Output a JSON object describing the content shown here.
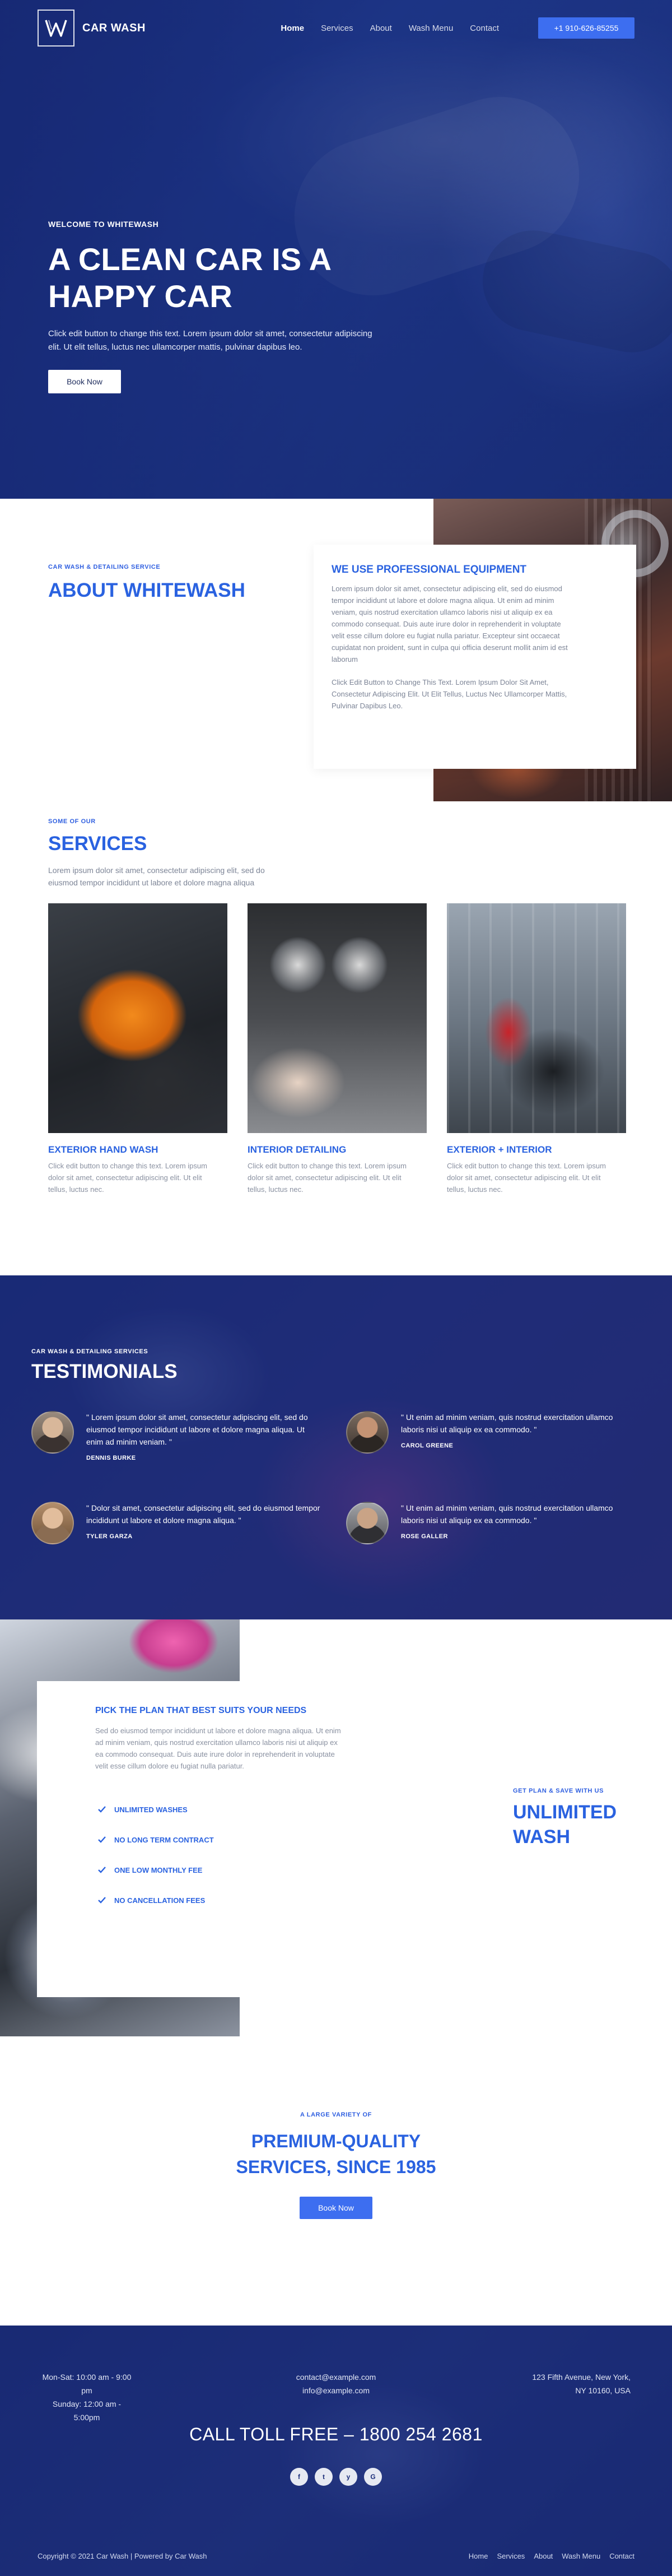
{
  "colors": {
    "brand_blue": "#2a62e0",
    "button_blue": "#3d6ef0",
    "dark_navy": "#1a2c78",
    "text_gray": "#7d8597"
  },
  "header": {
    "logo_icon": "w-monogram-logo",
    "brand": "CAR WASH",
    "nav": [
      "Home",
      "Services",
      "About",
      "Wash Menu",
      "Contact"
    ],
    "active_nav": "Home",
    "phone": "+1 910-626-85255"
  },
  "hero": {
    "eyebrow": "WELCOME TO WHITEWASH",
    "title": "A CLEAN CAR IS A HAPPY CAR",
    "text": "Click edit button to change this text. Lorem ipsum dolor sit amet, consectetur adipiscing elit. Ut elit tellus, luctus nec ullamcorper mattis, pulvinar dapibus leo.",
    "button": "Book Now"
  },
  "about": {
    "eyebrow": "CAR WASH & DETAILING SERVICE",
    "title": "ABOUT WHITEWASH",
    "card_heading": "WE USE PROFESSIONAL EQUIPMENT",
    "text1": "Lorem ipsum dolor sit amet, consectetur adipiscing elit, sed do eiusmod tempor incididunt ut labore et dolore magna aliqua. Ut enim ad minim veniam, quis nostrud exercitation ullamco laboris nisi ut aliquip ex ea commodo consequat. Duis aute irure dolor in reprehenderit in voluptate velit esse cillum dolore eu fugiat nulla pariatur. Excepteur sint occaecat cupidatat non proident, sunt in culpa qui officia deserunt mollit anim id est laborum",
    "text2": "Click Edit Button to Change This Text. Lorem Ipsum Dolor Sit Amet, Consectetur Adipiscing Elit. Ut Elit Tellus, Luctus Nec Ullamcorper Mattis, Pulvinar Dapibus Leo."
  },
  "services": {
    "eyebrow": "SOME OF OUR",
    "title": "SERVICES",
    "intro": "Lorem ipsum dolor sit amet, consectetur adipiscing elit, sed do eiusmod tempor incididunt ut labore et dolore magna aliqua",
    "items": [
      {
        "name": "EXTERIOR HAND WASH",
        "text": "Click edit button to change this text. Lorem ipsum dolor sit amet, consectetur adipiscing elit. Ut elit tellus, luctus nec."
      },
      {
        "name": "INTERIOR DETAILING",
        "text": "Click edit button to change this text. Lorem ipsum dolor sit amet, consectetur adipiscing elit. Ut elit tellus, luctus nec."
      },
      {
        "name": "EXTERIOR + INTERIOR",
        "text": "Click edit button to change this text. Lorem ipsum dolor sit amet, consectetur adipiscing elit. Ut elit tellus, luctus nec."
      }
    ]
  },
  "testimonials": {
    "eyebrow": "CAR WASH & DETAILING SERVICES",
    "title": "TESTIMONIALS",
    "items": [
      {
        "quote": "\" Lorem ipsum dolor sit amet, consectetur adipiscing elit, sed do eiusmod tempor incididunt ut labore et dolore magna aliqua. Ut enim ad minim veniam. \"",
        "author": "DENNIS BURKE"
      },
      {
        "quote": "\" Ut enim ad minim veniam, quis nostrud exercitation ullamco laboris nisi ut aliquip ex ea commodo. \"",
        "author": "CAROL GREENE"
      },
      {
        "quote": "\" Dolor sit amet, consectetur adipiscing elit, sed do eiusmod tempor incididunt ut labore et dolore magna aliqua. \"",
        "author": "TYLER GARZA"
      },
      {
        "quote": "\" Ut enim ad minim veniam, quis nostrud exercitation ullamco laboris nisi ut aliquip ex ea commodo. \"",
        "author": "ROSE GALLER"
      }
    ]
  },
  "plans": {
    "heading": "PICK THE PLAN THAT BEST SUITS YOUR NEEDS",
    "text": "Sed do eiusmod tempor incididunt ut labore et dolore magna aliqua. Ut enim ad minim veniam, quis nostrud exercitation ullamco laboris nisi ut aliquip ex ea commodo consequat. Duis aute irure dolor in reprehenderit in voluptate velit esse cillum dolore eu fugiat nulla pariatur.",
    "features": [
      "UNLIMITED WASHES",
      "NO LONG TERM CONTRACT",
      "ONE LOW MONTHLY FEE",
      "NO CANCELLATION FEES"
    ],
    "side_eyebrow": "GET PLAN & SAVE WITH US",
    "side_title": "UNLIMITED WASH"
  },
  "premium": {
    "eyebrow": "A LARGE VARIETY OF",
    "title": "PREMIUM-QUALITY SERVICES, SINCE 1985",
    "button": "Book Now"
  },
  "footer": {
    "hours_1": "Mon-Sat: 10:00 am - 9:00 pm",
    "hours_2": "Sunday: 12:00 am - 5:00pm",
    "email_1": "contact@example.com",
    "email_2": "info@example.com",
    "address_1": "123 Fifth Avenue, New York,",
    "address_2": "NY 10160, USA",
    "toll_free": "CALL TOLL FREE – 1800 254 2681",
    "socials": [
      {
        "icon": "facebook-icon",
        "glyph": "f"
      },
      {
        "icon": "twitter-icon",
        "glyph": "t"
      },
      {
        "icon": "yelp-icon",
        "glyph": "y"
      },
      {
        "icon": "google-icon",
        "glyph": "G"
      }
    ],
    "copyright": "Copyright © 2021 Car Wash | Powered by Car Wash",
    "nav": [
      "Home",
      "Services",
      "About",
      "Wash Menu",
      "Contact"
    ]
  }
}
